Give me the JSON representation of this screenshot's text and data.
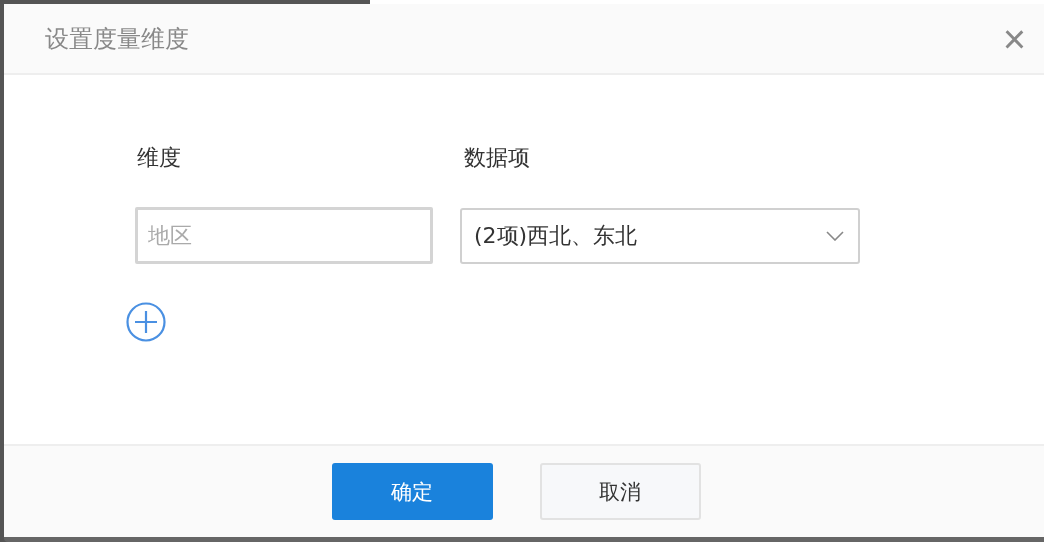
{
  "dialog": {
    "title": "设置度量维度",
    "close": "×"
  },
  "columns": [
    {
      "label": "维度"
    },
    {
      "label": "数据项"
    }
  ],
  "dimension_field": {
    "placeholder": "地区"
  },
  "data_items_select": {
    "value": "(2项)西北、东北"
  },
  "buttons": [
    {
      "label": "确定",
      "kind": "primary"
    },
    {
      "label": "取消",
      "kind": "secondary"
    }
  ]
}
